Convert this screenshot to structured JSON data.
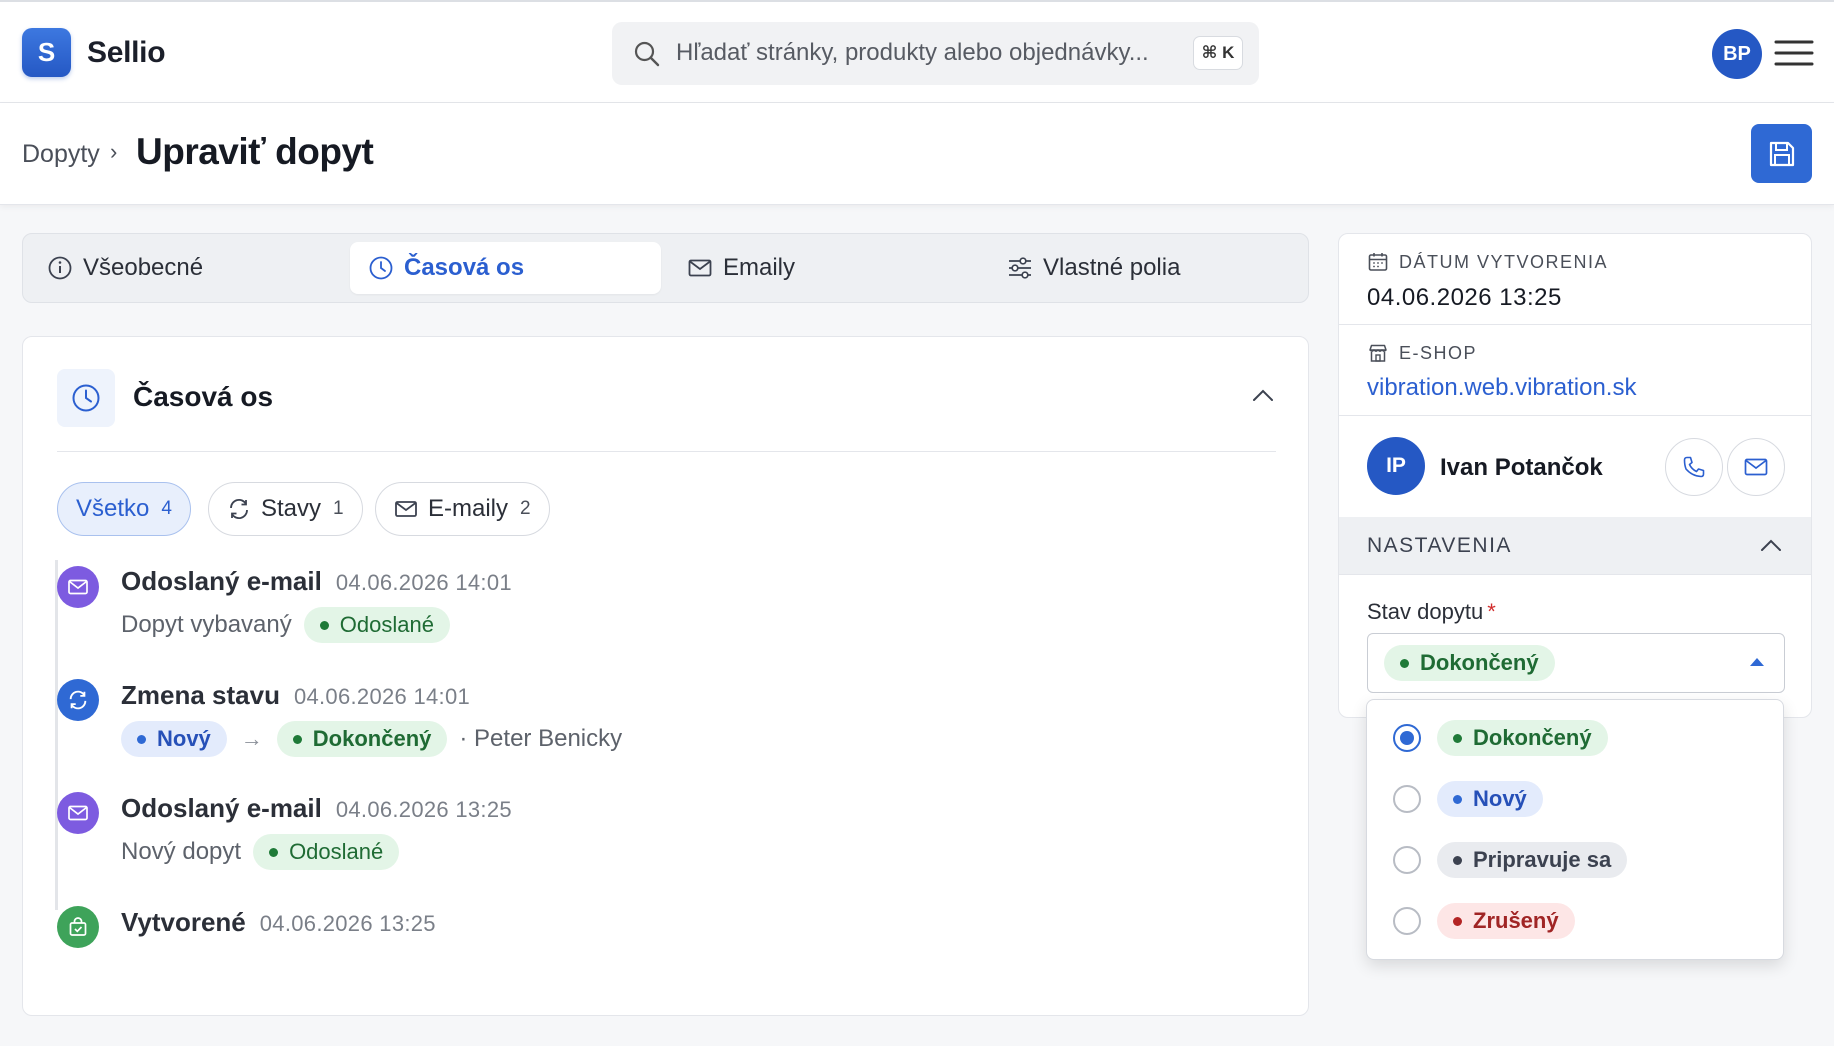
{
  "app": {
    "logo_letter": "S",
    "name": "Sellio"
  },
  "search": {
    "placeholder": "Hľadať stránky, produkty alebo objednávky...",
    "shortcut": "⌘ K"
  },
  "user": {
    "initials": "BP"
  },
  "header": {
    "breadcrumb": "Dopyty",
    "separator": "›",
    "title": "Upraviť dopyt"
  },
  "tabs": [
    {
      "label": "Všeobecné",
      "icon": "info-icon"
    },
    {
      "label": "Časová os",
      "icon": "clock-icon",
      "active": true
    },
    {
      "label": "Emaily",
      "icon": "mail-icon"
    },
    {
      "label": "Vlastné polia",
      "icon": "sliders-icon"
    }
  ],
  "timeline": {
    "title": "Časová os",
    "filters": [
      {
        "label": "Všetko",
        "count": "4",
        "active": true
      },
      {
        "label": "Stavy",
        "count": "1",
        "icon": "refresh-icon"
      },
      {
        "label": "E-maily",
        "count": "2",
        "icon": "mail-icon"
      }
    ],
    "events": [
      {
        "title": "Odoslaný e-mail",
        "time": "04.06.2026 14:01",
        "subtitle": "Dopyt vybavaný",
        "badge": "Odoslané",
        "icon": "mail-icon"
      },
      {
        "title": "Zmena stavu",
        "time": "04.06.2026 14:01",
        "from": "Nový",
        "arrow": "→",
        "to": "Dokončený",
        "by": "· Peter Benicky",
        "icon": "refresh-icon"
      },
      {
        "title": "Odoslaný e-mail",
        "time": "04.06.2026 13:25",
        "subtitle": "Nový dopyt",
        "badge": "Odoslané",
        "icon": "mail-icon"
      },
      {
        "title": "Vytvorené",
        "time": "04.06.2026 13:25",
        "icon": "bag-check-icon"
      }
    ]
  },
  "sidebar": {
    "created_label": "DÁTUM VYTVORENIA",
    "created_value": "04.06.2026 13:25",
    "eshop_label": "E-SHOP",
    "eshop_value": "vibration.web.vibration.sk",
    "person": {
      "initials": "IP",
      "name": "Ivan Potančok"
    },
    "settings_title": "NASTAVENIA",
    "status_label": "Stav dopytu",
    "required_mark": "*",
    "status_selected": "Dokončený",
    "status_options": [
      {
        "label": "Dokončený",
        "color": "#1f7a38",
        "selected": true
      },
      {
        "label": "Nový",
        "color": "#2f69d4"
      },
      {
        "label": "Pripravuje sa",
        "color": "#3c4250"
      },
      {
        "label": "Zrušený",
        "color": "#b32424"
      }
    ]
  },
  "colors": {
    "accent": "#2f69d4",
    "success": "#1f7a38",
    "purple": "#7d5be0",
    "danger": "#b32424"
  }
}
